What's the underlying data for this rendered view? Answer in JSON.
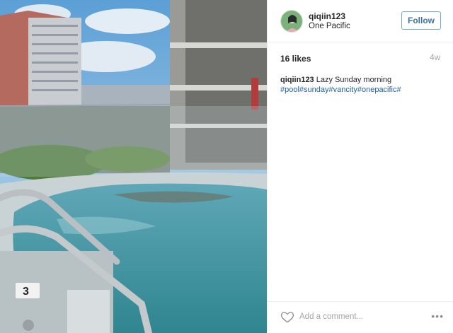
{
  "post": {
    "username": "qiqiin123",
    "location": "One Pacific",
    "follow_label": "Follow",
    "likes": "16 likes",
    "age": "4w",
    "caption_user": "qiqiin123",
    "caption_text": "Lazy Sunday morning",
    "caption_tags": "#pool#sunday#vancity#onepacific#",
    "comment_placeholder": "Add a comment...",
    "more_label": "•••",
    "pool_sign": "3"
  },
  "colors": {
    "follow_border": "#70a8d8",
    "follow_text": "#3f729b",
    "hashtag": "#1f5fa0",
    "muted": "#a5a5a5"
  },
  "icons": {
    "heart": "heart-icon",
    "more": "more-options-icon"
  }
}
